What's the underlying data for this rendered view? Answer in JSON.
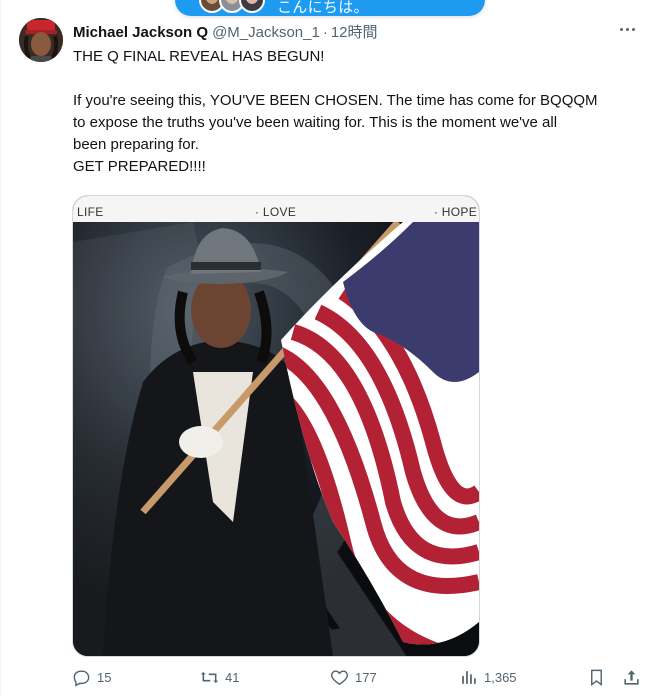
{
  "banner": {
    "text": "こんにちは。"
  },
  "tweet": {
    "display_name": "Michael Jackson Q",
    "handle": "@M_Jackson_1",
    "time": "12時間",
    "lines": [
      "THE Q FINAL REVEAL HAS BEGUN!",
      "",
      "If you're seeing this, YOU'VE BEEN CHOSEN.  The time has come for BQQQM",
      "to expose the truths you've been waiting for. This is the moment we've all",
      "been preparing for.",
      "GET PREPARED!!!!"
    ]
  },
  "media": {
    "banner_left": "LIFE",
    "banner_center": "· LOVE",
    "banner_right": "· HOPE"
  },
  "actions": {
    "replies": "15",
    "reposts": "41",
    "likes": "177",
    "views": "1,365"
  },
  "colors": {
    "accent": "#1d9bf0",
    "muted": "#536471",
    "flag_red": "#b22234",
    "flag_blue": "#3c3b6e"
  }
}
